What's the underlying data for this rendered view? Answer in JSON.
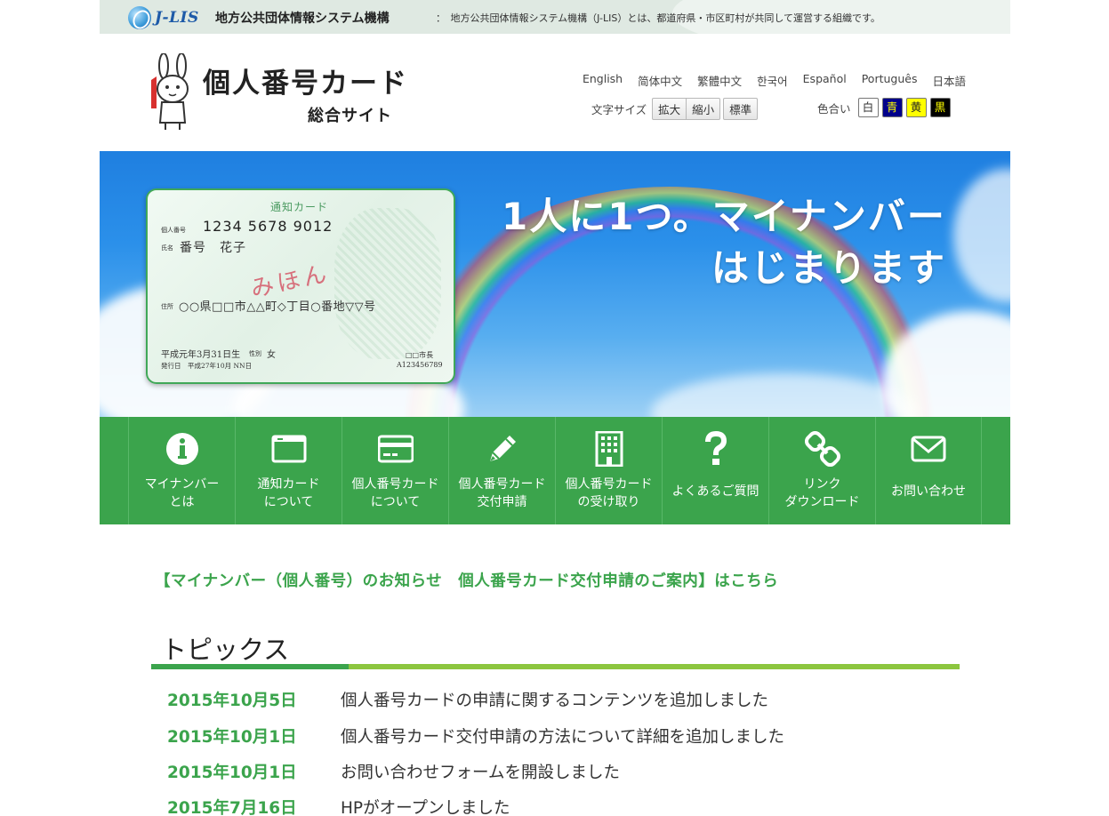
{
  "jlis": {
    "logo_text": "J-LIS",
    "org_name": "地方公共団体情報システム機構",
    "org_desc": "：　地方公共団体情報システム機構（J-LIS）とは、都道府県・市区町村が共同して運営する組織です。"
  },
  "header": {
    "site_title": "個人番号カード",
    "site_sub": "総合サイト",
    "languages": [
      "English",
      "简体中文",
      "繁體中文",
      "한국어",
      "Español",
      "Português",
      "日本語"
    ],
    "text_size": {
      "label": "文字サイズ",
      "enlarge": "拡大",
      "shrink": "縮小",
      "standard": "標準"
    },
    "color": {
      "label": "色合い",
      "white": "白",
      "blue": "青",
      "yellow": "黄",
      "black": "黒"
    }
  },
  "hero": {
    "copy_line1": "1人に1つ。マイナンバー",
    "copy_line2": "はじまります",
    "card": {
      "title": "通知カード",
      "number_label": "個人番号",
      "number": "1234 5678 9012",
      "name_label": "氏名",
      "name": "番号　花子",
      "sample": "みほん",
      "address_label": "住所",
      "address": "○○県□□市△△町◇丁目○番地▽▽号",
      "birth": "平成元年3月31日生",
      "gender_label": "性別",
      "gender": "女",
      "issue": "発行日　平成27年10月 NN日",
      "city": "□□市長",
      "id": "A123456789"
    }
  },
  "nav": {
    "items": [
      {
        "label": "マイナンバー\nとは",
        "icon": "info-icon"
      },
      {
        "label": "通知カード\nについて",
        "icon": "card-outline-icon"
      },
      {
        "label": "個人番号カード\nについて",
        "icon": "credit-card-icon"
      },
      {
        "label": "個人番号カード\n交付申請",
        "icon": "pencil-icon"
      },
      {
        "label": "個人番号カード\nの受け取り",
        "icon": "building-icon"
      },
      {
        "label": "よくあるご質問",
        "icon": "question-icon"
      },
      {
        "label": "リンク\nダウンロード",
        "icon": "link-icon"
      },
      {
        "label": "お問い合わせ",
        "icon": "envelope-icon"
      }
    ]
  },
  "notice": {
    "text": "【マイナンバー（個人番号）のお知らせ　個人番号カード交付申請のご案内】はこちら"
  },
  "topics": {
    "title": "トピックス",
    "items": [
      {
        "date": "2015年10月5日",
        "text": "個人番号カードの申請に関するコンテンツを追加しました"
      },
      {
        "date": "2015年10月1日",
        "text": "個人番号カード交付申請の方法について詳細を追加しました"
      },
      {
        "date": "2015年10月1日",
        "text": "お問い合わせフォームを開設しました"
      },
      {
        "date": "2015年7月16日",
        "text": "HPがオープンしました"
      }
    ]
  },
  "colors": {
    "brand_green": "#3ba44c",
    "accent_lightgreen": "#8cc63f",
    "jlis_blue": "#1d5aa8"
  }
}
